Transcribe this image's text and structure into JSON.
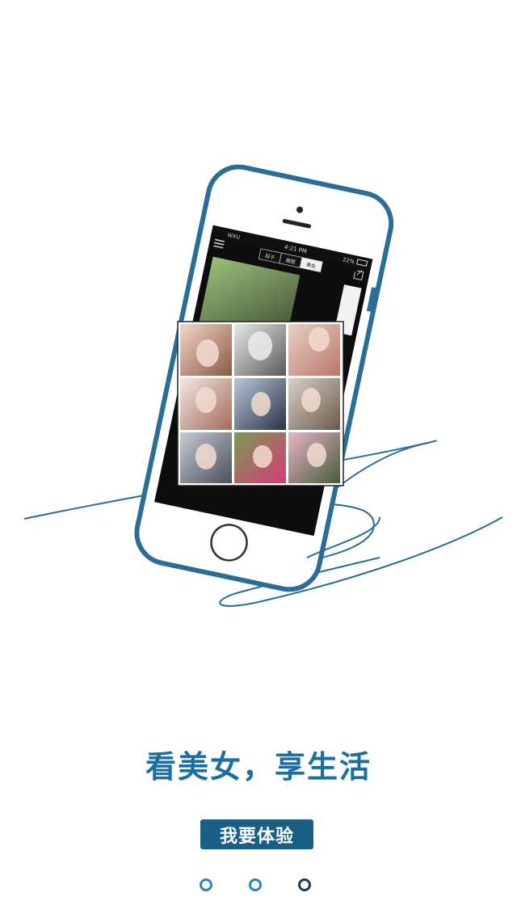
{
  "phone": {
    "carrier": "WXU",
    "time": "4:21 PM",
    "battery": "22%",
    "tabs": [
      "段子",
      "趣图",
      "美女"
    ],
    "selected_tab": "美女"
  },
  "tagline": "看美女，享生活",
  "cta_label": "我要体验",
  "pager": {
    "count": 3,
    "active_index": 2
  },
  "colors": {
    "accent": "#1a6fa0",
    "button": "#1b5f86",
    "phone_outline": "#2a6d96",
    "dot": "#2e86b8",
    "dot_active": "#1f3e53"
  },
  "icons": [
    "menu-icon",
    "wifi-icon",
    "battery-icon",
    "edit-icon",
    "home-button-icon"
  ]
}
